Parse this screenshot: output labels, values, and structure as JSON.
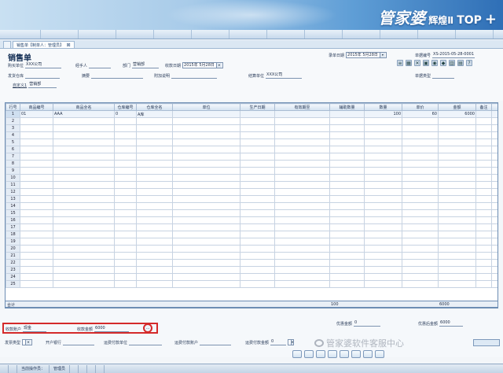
{
  "brand": {
    "name": "管家婆",
    "edition": "辉煌Ⅱ",
    "tier": "TOP",
    "plus": "+"
  },
  "menu": [
    "",
    "",
    "",
    "",
    "",
    "",
    "",
    "",
    "",
    "",
    "",
    "",
    ""
  ],
  "tabs": [
    {
      "label": ""
    },
    {
      "label": "销售单【制单人：管理员】"
    }
  ],
  "form": {
    "title": "销售单",
    "doc_date_label": "录单日期",
    "doc_date_value": "2015年 5月28日",
    "doc_no_label": "单据编号",
    "doc_no_value": "XS-2015-05-28-0001",
    "customer_label": "购买单位",
    "customer_value": "XXX公司",
    "handler_label": "经手人",
    "handler_value": "",
    "dept_label": "部门",
    "dept_value": "营销部",
    "due_date_label": "收款日期",
    "due_date_value": "2015年 5月28日",
    "warehouse_label": "发货仓库",
    "warehouse_value": "",
    "summary_label": "摘要",
    "summary_value": "",
    "note_label": "附加说明",
    "note_value": "",
    "contact_label": "结算单位",
    "contact_value": "XXX公司",
    "doc_type_label": "单据类型",
    "doc_type_value": "",
    "custom_label": "自定义1",
    "custom_value": "营销部"
  },
  "grid": {
    "columns": [
      "行号",
      "商品编号",
      "商品全名",
      "仓库编号",
      "仓库全名",
      "单位",
      "生产日期",
      "有效期至",
      "辅助数量",
      "数量",
      "单价",
      "金额",
      "备注",
      ""
    ],
    "rows": [
      [
        "1",
        "01",
        "AAA",
        "0",
        "A库",
        "",
        "",
        "",
        "",
        "100",
        "60",
        "6000",
        ""
      ]
    ],
    "total_rows": 25,
    "footer_label": "合计",
    "footer_qty": "100",
    "footer_amount": "6000"
  },
  "footer": {
    "account_label": "收款账户",
    "account_value": "现金",
    "amount_label": "收款金额",
    "amount_value": "6000",
    "discount_label": "优惠金额",
    "discount_value": "0",
    "after_discount_label": "优惠后金额",
    "after_discount_value": "6000",
    "invoice_type_label": "发票类型",
    "invoice_type_value": "",
    "bank_label": "开户银行",
    "bank_value": "",
    "ship_label": "运费付款单位",
    "ship_value": "",
    "ship_acct_label": "运费付款账户",
    "ship_acct_value": "",
    "ship_amt_label": "运费付款金额",
    "ship_amt_value": "0",
    "circle_btn": "...",
    "send_btn": ""
  },
  "buttons": [
    "",
    "",
    "",
    "",
    "",
    "",
    "",
    ""
  ],
  "watermark": "管家婆软件客服中心",
  "status": [
    "",
    "",
    "当前操作员：",
    "管理员",
    "",
    "",
    "",
    ""
  ]
}
